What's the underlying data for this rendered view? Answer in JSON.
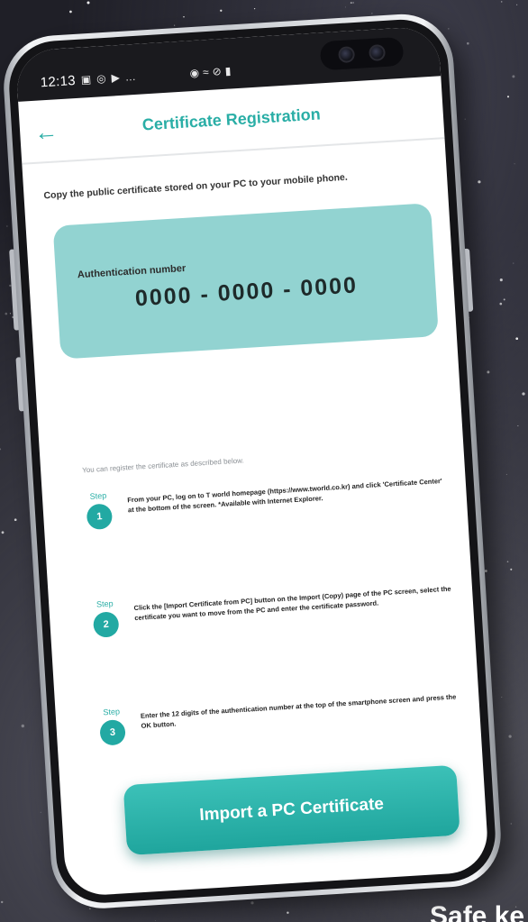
{
  "status_bar": {
    "time": "12:13",
    "left_icons": [
      "▣",
      "◎",
      "▶",
      "…"
    ],
    "right_icons": [
      "◉",
      "≈",
      "⊘",
      "▮"
    ]
  },
  "header": {
    "back_icon": "←",
    "title": "Certificate Registration"
  },
  "intro": "Copy the public certificate stored on your PC to your mobile phone.",
  "auth": {
    "label": "Authentication number",
    "number": "0000 - 0000 - 0000"
  },
  "guide": "You can register the certificate as described below.",
  "steps": [
    {
      "label": "Step",
      "number": "1",
      "text": "From your PC, log on to T world homepage (https://www.tworld.co.kr) and click 'Certificate Center' at the bottom of the screen. *Available with Internet Explorer."
    },
    {
      "label": "Step",
      "number": "2",
      "text": "Click the [Import Certificate from PC] button on the Import (Copy) page of the PC screen, select the certificate you want to move from the PC and enter the certificate password."
    },
    {
      "label": "Step",
      "number": "3",
      "text": "Enter the 12 digits of the authentication number at the top of the smartphone screen and press the OK button."
    }
  ],
  "import_button": "Import a PC Certificate",
  "promo": "Safe ke"
}
